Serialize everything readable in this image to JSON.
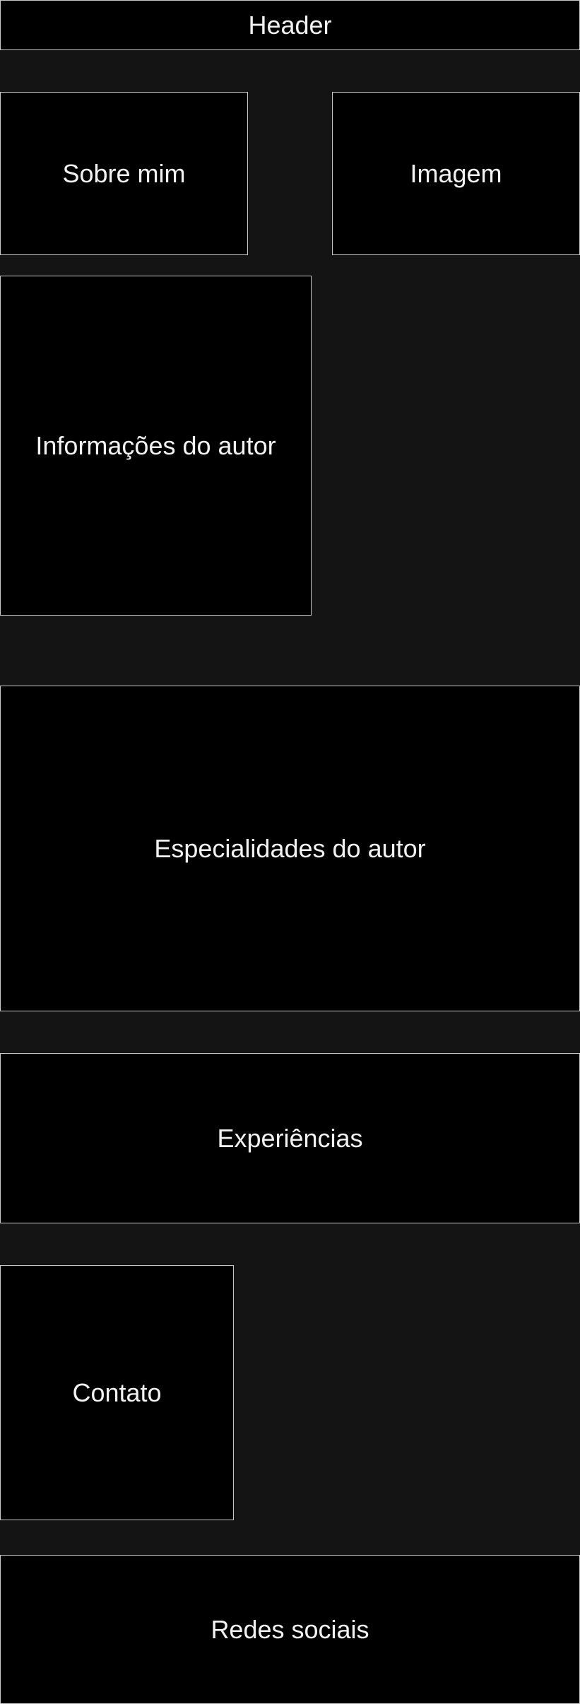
{
  "colors": {
    "page_background": "#141414",
    "box_fill": "#000000",
    "box_border": "#c8c8c8",
    "text": "#f2f2f2"
  },
  "sections": {
    "header": "Header",
    "about": "Sobre mim",
    "image": "Imagem",
    "author_info": "Informações do autor",
    "author_specialties": "Especialidades do autor",
    "experiences": "Experiências",
    "contact": "Contato",
    "social": "Redes sociais"
  }
}
